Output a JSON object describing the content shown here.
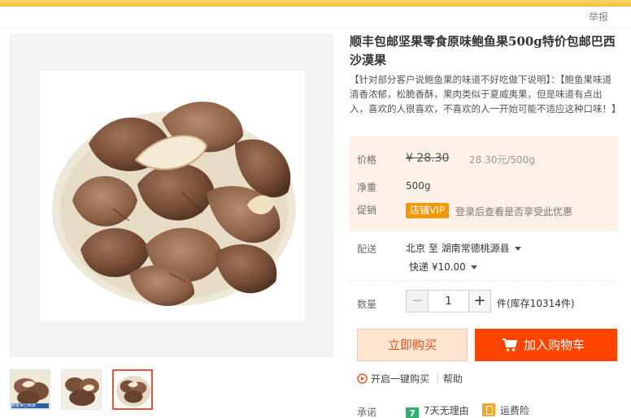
{
  "header": {
    "report_label": "举报"
  },
  "product": {
    "title": "顺丰包邮坚果零食原味鲍鱼果500g特价包邮巴西沙漠果",
    "subtitle": "【针对部分客户说鲍鱼果的味道不好吃做下说明】：【鲍鱼果味道清香浓郁，松脆香酥，果肉类似于夏威夷果，但是味道有点出入，喜欢的人很喜欢，不喜欢的人一开始可能不适应这种口味！】"
  },
  "thumbnails": [
    {
      "label": "鲍鱼果巴西果",
      "active": false
    },
    {
      "label": "",
      "active": false
    },
    {
      "label": "",
      "active": true
    }
  ],
  "price": {
    "label": "价格",
    "original": "¥ 28.30",
    "unit_price": "28.30元/500g"
  },
  "net_weight": {
    "label": "净重",
    "value": "500g"
  },
  "promotion": {
    "label": "促销",
    "badge": "店铺VIP",
    "text": "登录后查看是否享受此优惠"
  },
  "shipping": {
    "label": "配送",
    "route": "北京 至  湖南常德桃源县",
    "method": "快递 ¥10.00"
  },
  "quantity": {
    "label": "数量",
    "value": "1",
    "minus": "−",
    "plus": "+",
    "stock": "件(库存10314件)"
  },
  "actions": {
    "buy_now": "立即购买",
    "add_cart": "加入购物车",
    "one_click": "开启一键购买",
    "help": "帮助"
  },
  "promise": {
    "label": "承诺",
    "badge_7": "7",
    "item_1": "7天无理由",
    "item_2": "运费险"
  },
  "colors": {
    "accent": "#ff4400",
    "buy_now_bg": "#ffe4d0",
    "price_panel_bg": "#fdf0e7",
    "vip_badge": "#f39800",
    "seven_day_badge": "#2fb26b"
  },
  "icons": [
    "cart-icon",
    "play-circle-icon",
    "seven-day-icon",
    "insurance-icon",
    "caret-down-icon"
  ]
}
